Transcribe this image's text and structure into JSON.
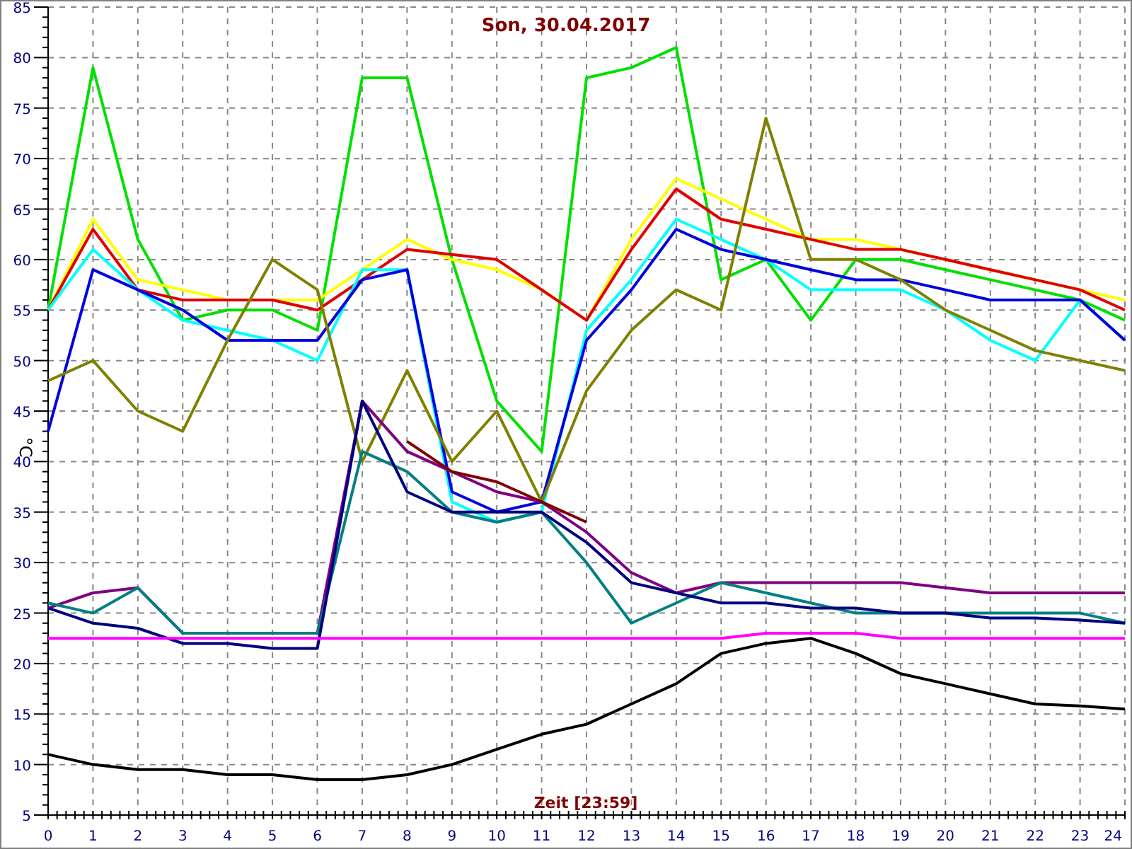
{
  "chart_data": {
    "type": "line",
    "grid": true,
    "title": "Son, 30.04.2017",
    "xlabel": "Zeit [23:59]",
    "ylabel": "°C",
    "x": [
      0,
      1,
      2,
      3,
      4,
      5,
      6,
      7,
      8,
      9,
      10,
      11,
      12,
      13,
      14,
      15,
      16,
      17,
      18,
      19,
      20,
      21,
      22,
      23,
      24
    ],
    "xlim": [
      0,
      24
    ],
    "ylim": [
      5,
      85
    ],
    "xticks": [
      0,
      1,
      2,
      3,
      4,
      5,
      6,
      7,
      8,
      9,
      10,
      11,
      12,
      13,
      14,
      15,
      16,
      17,
      18,
      19,
      20,
      21,
      22,
      23,
      24
    ],
    "yticks": [
      5,
      10,
      15,
      20,
      25,
      30,
      35,
      40,
      45,
      50,
      55,
      60,
      65,
      70,
      75,
      80,
      85
    ],
    "series": [
      {
        "color": "#00e000",
        "values": [
          55,
          79,
          62,
          54,
          55,
          55,
          53,
          78,
          78,
          60,
          46,
          41,
          78,
          79,
          81,
          58,
          60,
          54,
          60,
          60,
          59,
          58,
          57,
          56,
          54
        ]
      },
      {
        "color": "#ffff00",
        "values": [
          55,
          64,
          58,
          57,
          56,
          56,
          56,
          59,
          62,
          60,
          59,
          57,
          54,
          62,
          68,
          66,
          64,
          62,
          62,
          61,
          60,
          59,
          58,
          57,
          56
        ]
      },
      {
        "color": "#e00000",
        "values": [
          55,
          63,
          57,
          56,
          56,
          56,
          55,
          58,
          61,
          60.5,
          60,
          57,
          54,
          61,
          67,
          64,
          63,
          62,
          61,
          61,
          60,
          59,
          58,
          57,
          55
        ]
      },
      {
        "color": "#00ffff",
        "values": [
          55,
          61,
          57,
          54,
          53,
          52,
          50,
          59,
          59,
          36,
          34,
          35,
          53,
          58,
          64,
          62,
          60,
          57,
          57,
          57,
          55,
          52,
          50,
          56,
          52
        ]
      },
      {
        "color": "#0000e0",
        "values": [
          43,
          59,
          57,
          55,
          52,
          52,
          52,
          58,
          59,
          37,
          35,
          36,
          52,
          57,
          63,
          61,
          60,
          59,
          58,
          58,
          57,
          56,
          56,
          56,
          52
        ]
      },
      {
        "color": "#808000",
        "values": [
          48,
          50,
          45,
          43,
          52,
          60,
          57,
          40,
          49,
          40,
          45,
          36,
          47,
          53,
          57,
          55,
          74,
          60,
          60,
          58,
          55,
          53,
          51,
          50,
          49
        ]
      },
      {
        "color": "#800080",
        "values": [
          25.5,
          27,
          27.5,
          23,
          23,
          23,
          23,
          46,
          41,
          39,
          37,
          36,
          33,
          29,
          27,
          28,
          28,
          28,
          28,
          28,
          27.5,
          27,
          27,
          27,
          27
        ]
      },
      {
        "color": "#800000",
        "values": [
          null,
          null,
          null,
          null,
          null,
          null,
          null,
          null,
          42,
          39,
          38,
          36,
          34,
          null,
          null,
          null,
          null,
          null,
          null,
          null,
          null,
          null,
          null,
          null,
          null
        ]
      },
      {
        "color": "#008080",
        "values": [
          26,
          25,
          27.5,
          23,
          23,
          23,
          23,
          41,
          39,
          35,
          34,
          35,
          30,
          24,
          26,
          28,
          27,
          26,
          25,
          25,
          25,
          25,
          25,
          25,
          24
        ]
      },
      {
        "color": "#000080",
        "values": [
          25.5,
          24,
          23.5,
          22,
          22,
          21.5,
          21.5,
          46,
          37,
          35,
          35,
          35,
          32,
          28,
          27,
          26,
          26,
          25.5,
          25.5,
          25,
          25,
          24.5,
          24.5,
          24.3,
          24
        ]
      },
      {
        "color": "#ff00ff",
        "values": [
          22.5,
          22.5,
          22.5,
          22.5,
          22.5,
          22.5,
          22.5,
          22.5,
          22.5,
          22.5,
          22.5,
          22.5,
          22.5,
          22.5,
          22.5,
          22.5,
          23,
          23,
          23,
          22.5,
          22.5,
          22.5,
          22.5,
          22.5,
          22.5
        ]
      },
      {
        "color": "#000000",
        "values": [
          11,
          10,
          9.5,
          9.5,
          9,
          9,
          8.5,
          8.5,
          9,
          10,
          11.5,
          13,
          14,
          16,
          18,
          21,
          22,
          22.5,
          21,
          19,
          18,
          17,
          16,
          15.8,
          15.5
        ]
      }
    ]
  }
}
